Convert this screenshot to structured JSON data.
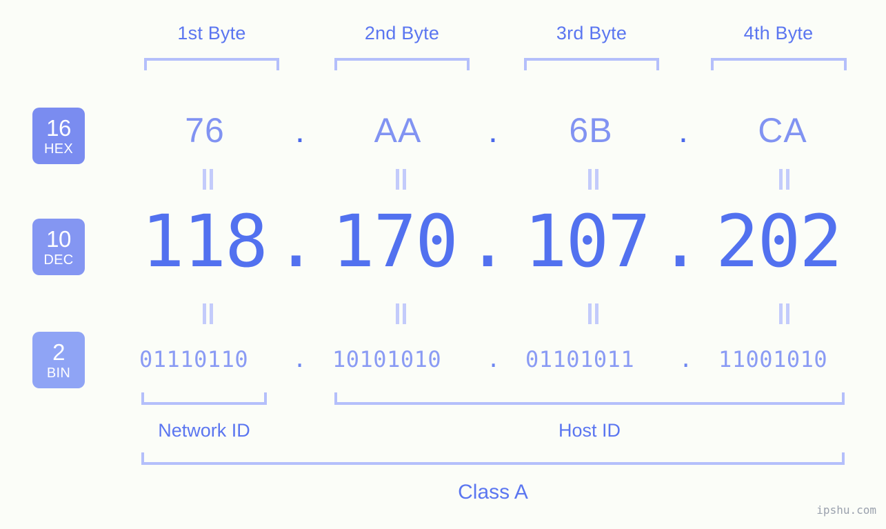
{
  "page": {
    "background_color": "#fbfdf8",
    "accent_color": "#5271ef",
    "bracket_color": "#b4bffb",
    "watermark": "ipshu.com"
  },
  "byte_headers": [
    {
      "label": "1st Byte"
    },
    {
      "label": "2nd Byte"
    },
    {
      "label": "3rd Byte"
    },
    {
      "label": "4th Byte"
    }
  ],
  "bases": [
    {
      "number": "16",
      "name": "HEX",
      "color": "#7a8cf0"
    },
    {
      "number": "10",
      "name": "DEC",
      "color": "#8496f2"
    },
    {
      "number": "2",
      "name": "BIN",
      "color": "#8fa4f5"
    }
  ],
  "rows": {
    "hex": {
      "base_number": "16",
      "base_name": "HEX",
      "values": [
        "76",
        "AA",
        "6B",
        "CA"
      ],
      "separator": "."
    },
    "dec": {
      "base_number": "10",
      "base_name": "DEC",
      "values": [
        "118",
        "170",
        "107",
        "202"
      ],
      "separator": "."
    },
    "bin": {
      "base_number": "2",
      "base_name": "BIN",
      "values": [
        "01110110",
        "10101010",
        "01101011",
        "11001010"
      ],
      "separator": "."
    }
  },
  "equals_marks": {
    "glyph": "=",
    "count_per_row": 4
  },
  "segments": {
    "network_id": "Network ID",
    "host_id": "Host ID",
    "ip_class": "Class A"
  }
}
